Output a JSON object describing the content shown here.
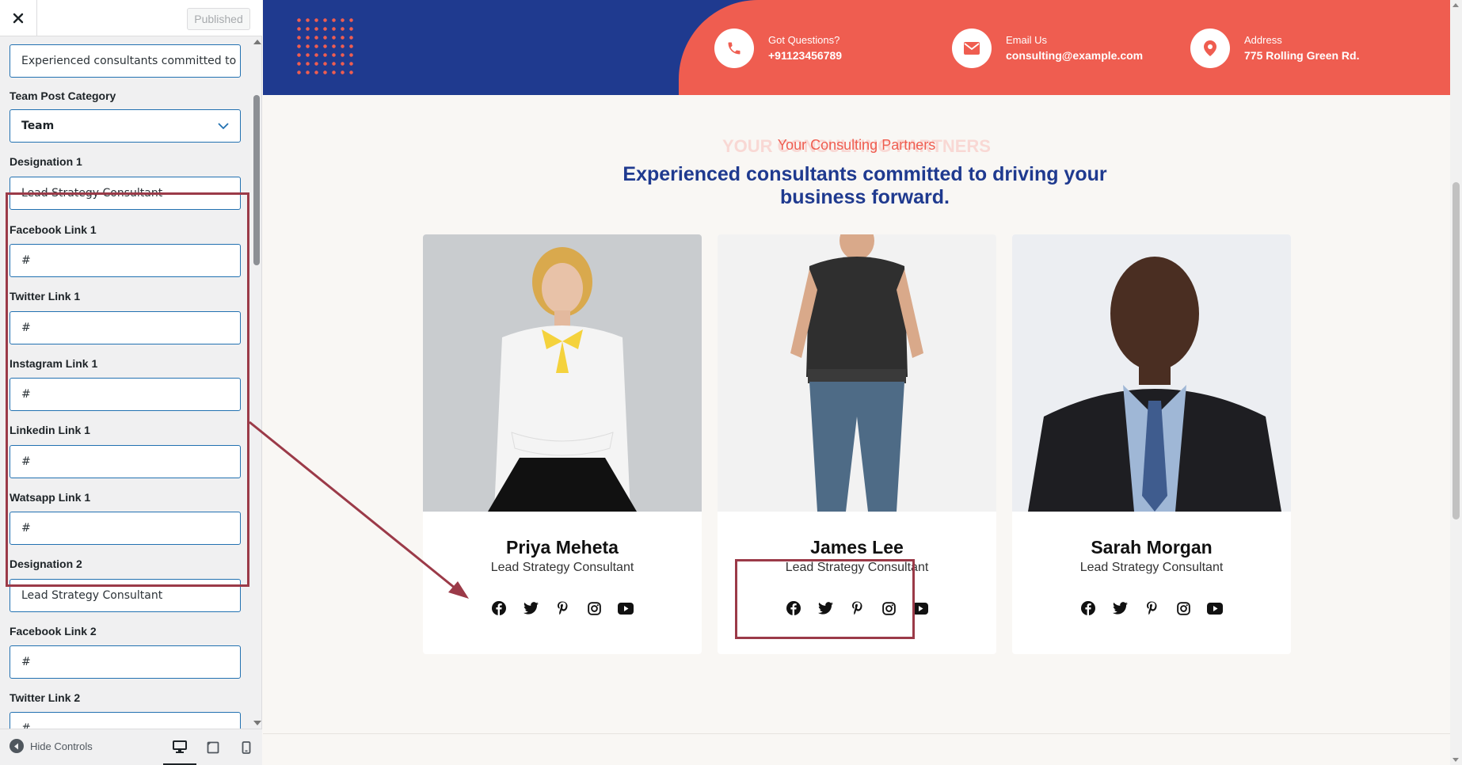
{
  "sidebar": {
    "header": {
      "published_label": "Published"
    },
    "fields": {
      "subtitle_value": "Experienced consultants committed to dr",
      "category_label": "Team Post Category",
      "category_value": "Team",
      "designation1_label": "Designation 1",
      "designation1_value": "Lead Strategy Consultant",
      "facebook1_label": "Facebook Link 1",
      "facebook1_value": "#",
      "twitter1_label": "Twitter Link 1",
      "twitter1_value": "#",
      "instagram1_label": "Instagram Link 1",
      "instagram1_value": "#",
      "linkedin1_label": "Linkedin Link 1",
      "linkedin1_value": "#",
      "watsapp1_label": "Watsapp Link 1",
      "watsapp1_value": "#",
      "designation2_label": "Designation 2",
      "designation2_value": "Lead Strategy Consultant",
      "facebook2_label": "Facebook Link 2",
      "facebook2_value": "#",
      "twitter2_label": "Twitter Link 2",
      "twitter2_value": "#"
    },
    "footer": {
      "hide_controls": "Hide Controls"
    }
  },
  "preview": {
    "contacts": [
      {
        "label": "Got Questions?",
        "value": "+91123456789",
        "icon": "phone-icon"
      },
      {
        "label": "Email Us",
        "value": "consulting@example.com",
        "icon": "envelope-icon"
      },
      {
        "label": "Address",
        "value": "775 Rolling Green Rd.",
        "icon": "location-pin-icon"
      }
    ],
    "section": {
      "watermark": "YOUR CONSULTING PARTNERS",
      "subtitle": "Your Consulting Partners",
      "title": "Experienced consultants committed to driving your business forward."
    },
    "team": [
      {
        "name": "Priya Meheta",
        "role": "Lead Strategy Consultant"
      },
      {
        "name": "James Lee",
        "role": "Lead Strategy Consultant"
      },
      {
        "name": "Sarah Morgan",
        "role": "Lead Strategy Consultant"
      }
    ]
  },
  "colors": {
    "navy": "#1f3a8f",
    "coral": "#ef5d50",
    "highlight": "#9b3a48",
    "input_border": "#2271b1"
  }
}
